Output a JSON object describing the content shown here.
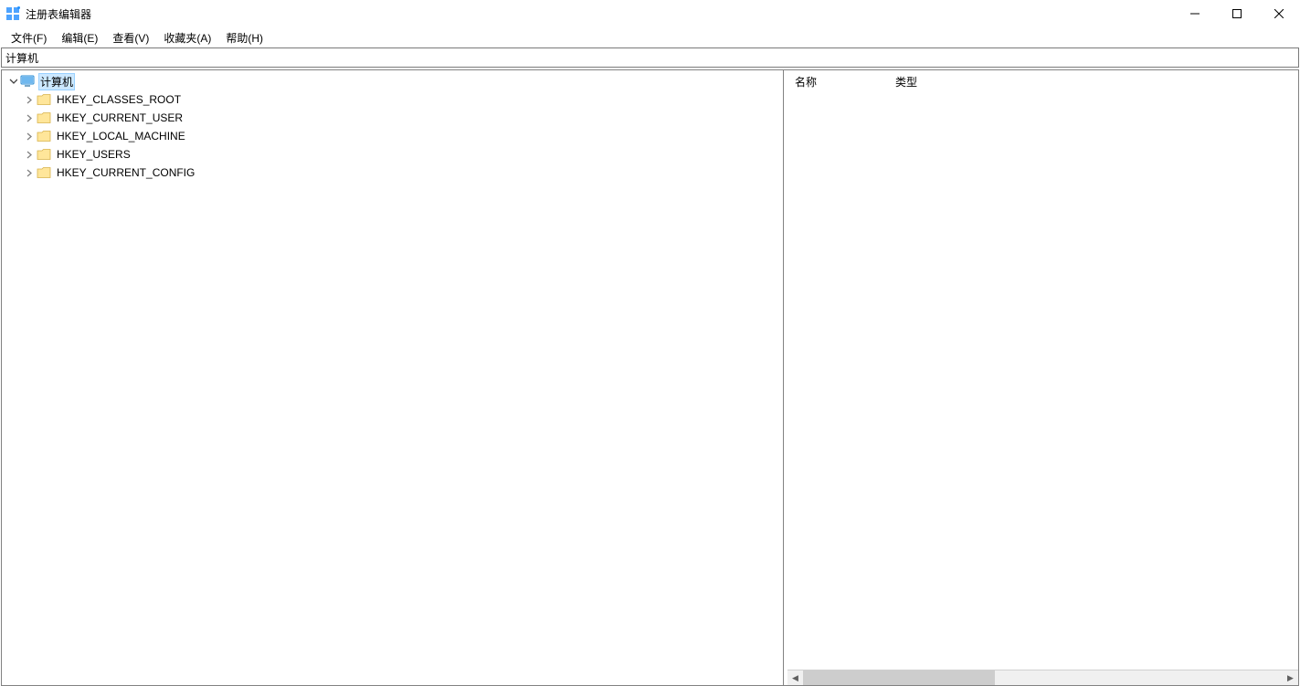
{
  "window": {
    "title": "注册表编辑器"
  },
  "menubar": {
    "file": "文件(F)",
    "edit": "编辑(E)",
    "view": "查看(V)",
    "favorites": "收藏夹(A)",
    "help": "帮助(H)"
  },
  "path": "计算机",
  "tree": {
    "root_label": "计算机",
    "hives": [
      "HKEY_CLASSES_ROOT",
      "HKEY_CURRENT_USER",
      "HKEY_LOCAL_MACHINE",
      "HKEY_USERS",
      "HKEY_CURRENT_CONFIG"
    ]
  },
  "values": {
    "columns": {
      "name": "名称",
      "type": "类型"
    }
  }
}
